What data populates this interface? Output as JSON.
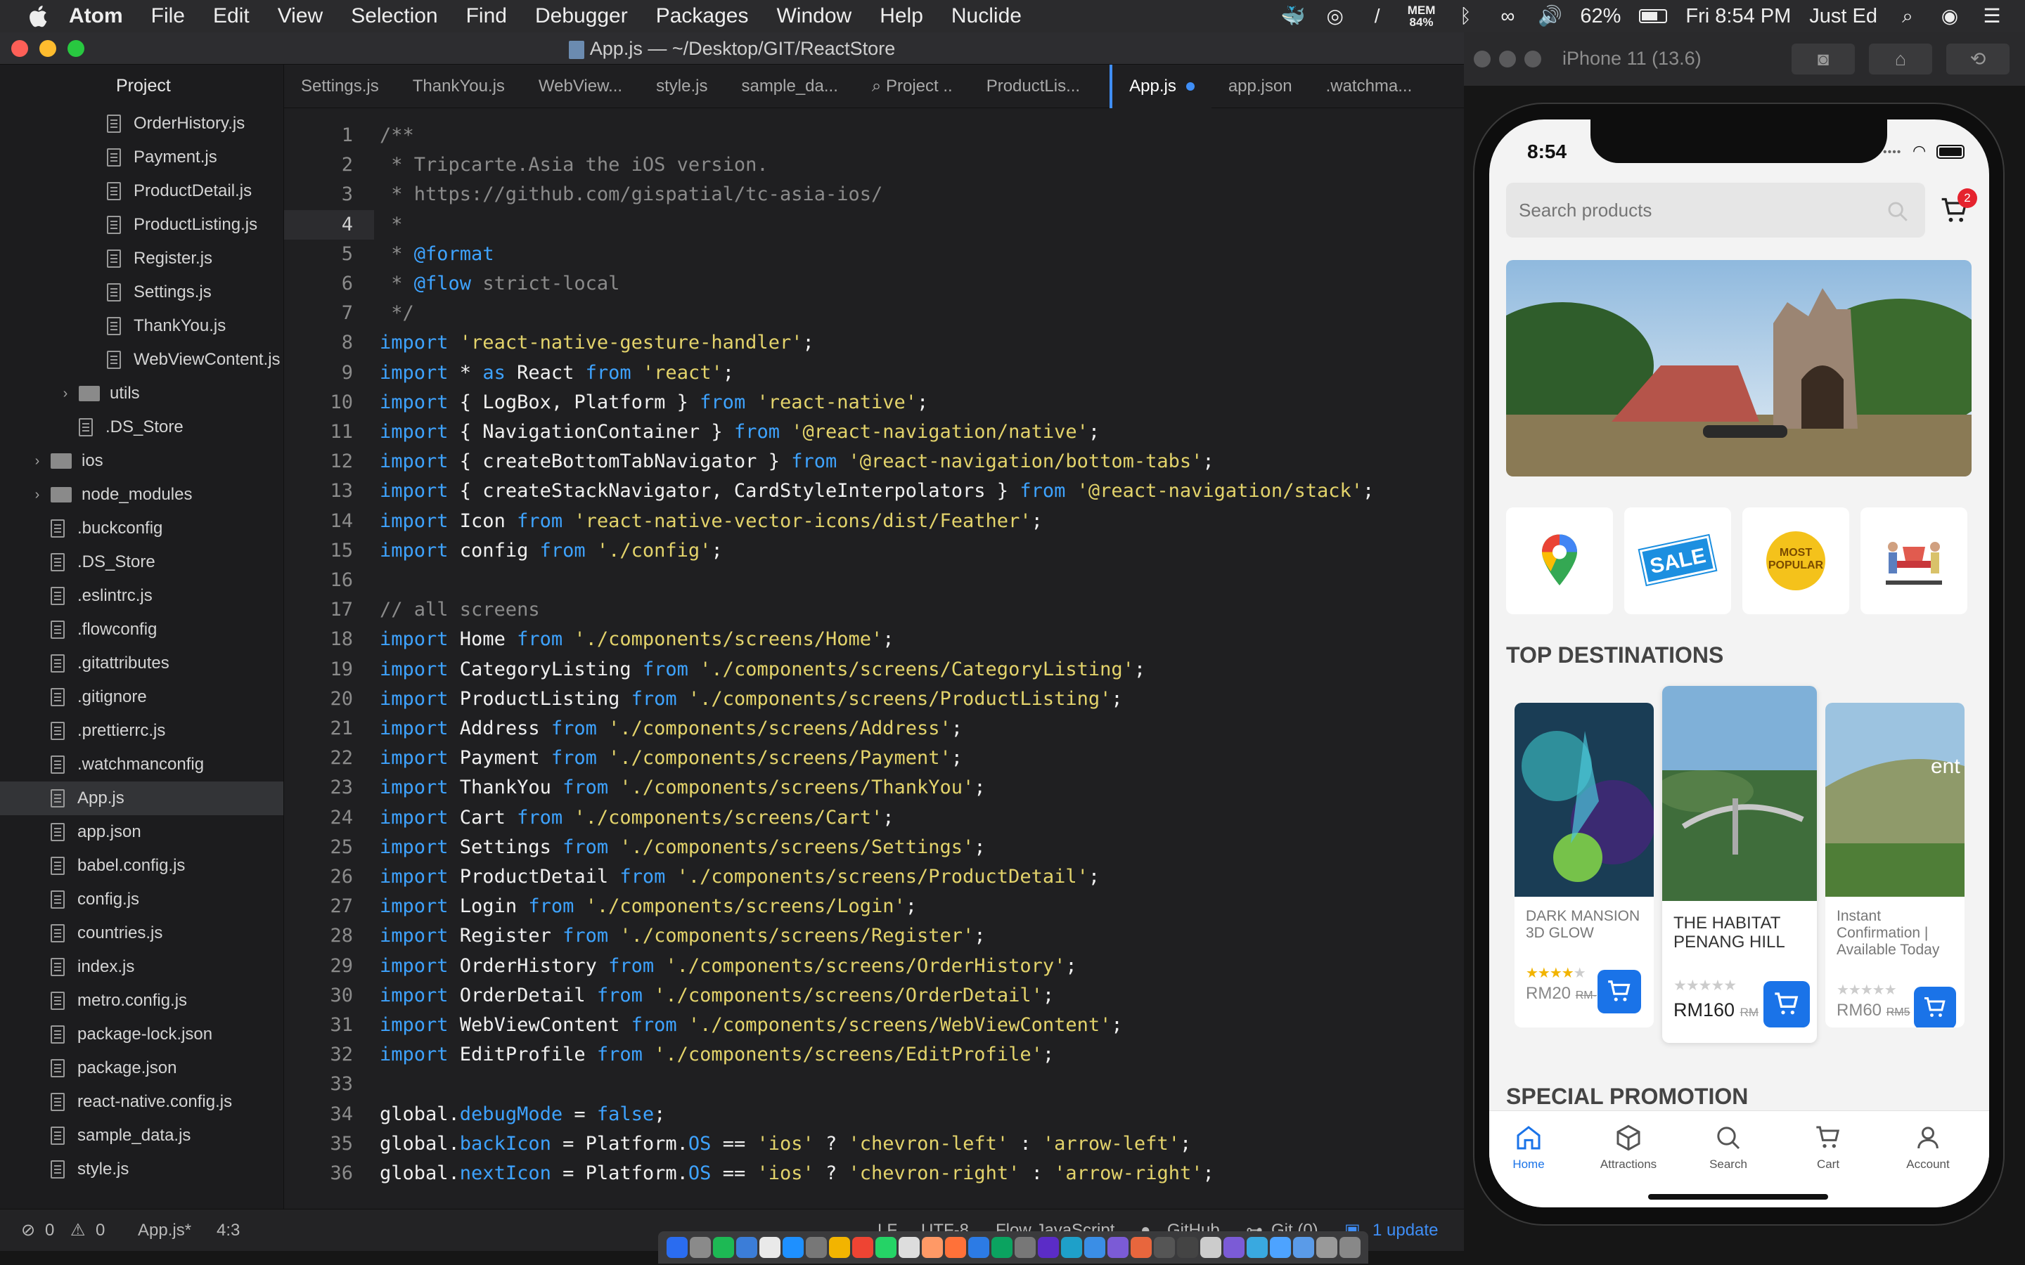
{
  "menubar": {
    "app": "Atom",
    "items": [
      "File",
      "Edit",
      "View",
      "Selection",
      "Find",
      "Debugger",
      "Packages",
      "Window",
      "Help",
      "Nuclide"
    ],
    "mem_label": "MEM",
    "mem_value": "84%",
    "battery": "62%",
    "clock": "Fri 8:54 PM",
    "user": "Just Ed"
  },
  "atom": {
    "title": "App.js — ~/Desktop/GIT/ReactStore",
    "panel_title": "Project",
    "tree": [
      {
        "label": "OrderHistory.js",
        "kind": "file",
        "indent": 2
      },
      {
        "label": "Payment.js",
        "kind": "file",
        "indent": 2
      },
      {
        "label": "ProductDetail.js",
        "kind": "file",
        "indent": 2
      },
      {
        "label": "ProductListing.js",
        "kind": "file",
        "indent": 2
      },
      {
        "label": "Register.js",
        "kind": "file",
        "indent": 2
      },
      {
        "label": "Settings.js",
        "kind": "file",
        "indent": 2
      },
      {
        "label": "ThankYou.js",
        "kind": "file",
        "indent": 2
      },
      {
        "label": "WebViewContent.js",
        "kind": "file",
        "indent": 2
      },
      {
        "label": "utils",
        "kind": "folder",
        "indent": 1
      },
      {
        "label": ".DS_Store",
        "kind": "file",
        "indent": 1
      },
      {
        "label": "ios",
        "kind": "folder",
        "indent": 0
      },
      {
        "label": "node_modules",
        "kind": "folder",
        "indent": 0
      },
      {
        "label": ".buckconfig",
        "kind": "file",
        "indent": 0
      },
      {
        "label": ".DS_Store",
        "kind": "file",
        "indent": 0
      },
      {
        "label": ".eslintrc.js",
        "kind": "file",
        "indent": 0
      },
      {
        "label": ".flowconfig",
        "kind": "file",
        "indent": 0
      },
      {
        "label": ".gitattributes",
        "kind": "file",
        "indent": 0
      },
      {
        "label": ".gitignore",
        "kind": "file",
        "indent": 0
      },
      {
        "label": ".prettierrc.js",
        "kind": "file",
        "indent": 0
      },
      {
        "label": ".watchmanconfig",
        "kind": "file",
        "indent": 0
      },
      {
        "label": "App.js",
        "kind": "file",
        "indent": 0,
        "selected": true
      },
      {
        "label": "app.json",
        "kind": "file",
        "indent": 0
      },
      {
        "label": "babel.config.js",
        "kind": "file",
        "indent": 0
      },
      {
        "label": "config.js",
        "kind": "file",
        "indent": 0
      },
      {
        "label": "countries.js",
        "kind": "file",
        "indent": 0
      },
      {
        "label": "index.js",
        "kind": "file",
        "indent": 0
      },
      {
        "label": "metro.config.js",
        "kind": "file",
        "indent": 0
      },
      {
        "label": "package-lock.json",
        "kind": "file",
        "indent": 0
      },
      {
        "label": "package.json",
        "kind": "file",
        "indent": 0
      },
      {
        "label": "react-native.config.js",
        "kind": "file",
        "indent": 0
      },
      {
        "label": "sample_data.js",
        "kind": "file",
        "indent": 0
      },
      {
        "label": "style.js",
        "kind": "file",
        "indent": 0
      }
    ],
    "tabs": [
      {
        "label": "Settings.js"
      },
      {
        "label": "ThankYou.js"
      },
      {
        "label": "WebView..."
      },
      {
        "label": "style.js"
      },
      {
        "label": "sample_da..."
      },
      {
        "label": "Project ..",
        "search": true
      },
      {
        "label": "ProductLis..."
      },
      {
        "label": "App.js",
        "active": true,
        "modified": true
      },
      {
        "label": "app.json"
      },
      {
        "label": ".watchma..."
      }
    ],
    "cursor_line": 4,
    "code": [
      [
        [
          "c",
          "/**"
        ]
      ],
      [
        [
          "c",
          " * Tripcarte.Asia the iOS version."
        ]
      ],
      [
        [
          "c",
          " * https://github.com/gispatial/tc-asia-ios/"
        ]
      ],
      [
        [
          "c",
          " *"
        ]
      ],
      [
        [
          "c",
          " * "
        ],
        [
          "k",
          "@format"
        ]
      ],
      [
        [
          "c",
          " * "
        ],
        [
          "k",
          "@flow"
        ],
        [
          "c",
          " strict-local"
        ]
      ],
      [
        [
          "c",
          " */"
        ]
      ],
      [
        [
          "k",
          "import "
        ],
        [
          "s",
          "'react-native-gesture-handler'"
        ],
        [
          "n",
          ";"
        ]
      ],
      [
        [
          "k",
          "import "
        ],
        [
          "n",
          "* "
        ],
        [
          "k",
          "as "
        ],
        [
          "n",
          "React "
        ],
        [
          "k",
          "from "
        ],
        [
          "s",
          "'react'"
        ],
        [
          "n",
          ";"
        ]
      ],
      [
        [
          "k",
          "import "
        ],
        [
          "n",
          "{ LogBox, Platform } "
        ],
        [
          "k",
          "from "
        ],
        [
          "s",
          "'react-native'"
        ],
        [
          "n",
          ";"
        ]
      ],
      [
        [
          "k",
          "import "
        ],
        [
          "n",
          "{ NavigationContainer } "
        ],
        [
          "k",
          "from "
        ],
        [
          "s",
          "'@react-navigation/native'"
        ],
        [
          "n",
          ";"
        ]
      ],
      [
        [
          "k",
          "import "
        ],
        [
          "n",
          "{ createBottomTabNavigator } "
        ],
        [
          "k",
          "from "
        ],
        [
          "s",
          "'@react-navigation/bottom-tabs'"
        ],
        [
          "n",
          ";"
        ]
      ],
      [
        [
          "k",
          "import "
        ],
        [
          "n",
          "{ createStackNavigator, CardStyleInterpolators } "
        ],
        [
          "k",
          "from "
        ],
        [
          "s",
          "'@react-navigation/stack'"
        ],
        [
          "n",
          ";"
        ]
      ],
      [
        [
          "k",
          "import "
        ],
        [
          "n",
          "Icon "
        ],
        [
          "k",
          "from "
        ],
        [
          "s",
          "'react-native-vector-icons/dist/Feather'"
        ],
        [
          "n",
          ";"
        ]
      ],
      [
        [
          "k",
          "import "
        ],
        [
          "n",
          "config "
        ],
        [
          "k",
          "from "
        ],
        [
          "s",
          "'./config'"
        ],
        [
          "n",
          ";"
        ]
      ],
      [],
      [
        [
          "c",
          "// all screens"
        ]
      ],
      [
        [
          "k",
          "import "
        ],
        [
          "n",
          "Home "
        ],
        [
          "k",
          "from "
        ],
        [
          "s",
          "'./components/screens/Home'"
        ],
        [
          "n",
          ";"
        ]
      ],
      [
        [
          "k",
          "import "
        ],
        [
          "n",
          "CategoryListing "
        ],
        [
          "k",
          "from "
        ],
        [
          "s",
          "'./components/screens/CategoryListing'"
        ],
        [
          "n",
          ";"
        ]
      ],
      [
        [
          "k",
          "import "
        ],
        [
          "n",
          "ProductListing "
        ],
        [
          "k",
          "from "
        ],
        [
          "s",
          "'./components/screens/ProductListing'"
        ],
        [
          "n",
          ";"
        ]
      ],
      [
        [
          "k",
          "import "
        ],
        [
          "n",
          "Address "
        ],
        [
          "k",
          "from "
        ],
        [
          "s",
          "'./components/screens/Address'"
        ],
        [
          "n",
          ";"
        ]
      ],
      [
        [
          "k",
          "import "
        ],
        [
          "n",
          "Payment "
        ],
        [
          "k",
          "from "
        ],
        [
          "s",
          "'./components/screens/Payment'"
        ],
        [
          "n",
          ";"
        ]
      ],
      [
        [
          "k",
          "import "
        ],
        [
          "n",
          "ThankYou "
        ],
        [
          "k",
          "from "
        ],
        [
          "s",
          "'./components/screens/ThankYou'"
        ],
        [
          "n",
          ";"
        ]
      ],
      [
        [
          "k",
          "import "
        ],
        [
          "n",
          "Cart "
        ],
        [
          "k",
          "from "
        ],
        [
          "s",
          "'./components/screens/Cart'"
        ],
        [
          "n",
          ";"
        ]
      ],
      [
        [
          "k",
          "import "
        ],
        [
          "n",
          "Settings "
        ],
        [
          "k",
          "from "
        ],
        [
          "s",
          "'./components/screens/Settings'"
        ],
        [
          "n",
          ";"
        ]
      ],
      [
        [
          "k",
          "import "
        ],
        [
          "n",
          "ProductDetail "
        ],
        [
          "k",
          "from "
        ],
        [
          "s",
          "'./components/screens/ProductDetail'"
        ],
        [
          "n",
          ";"
        ]
      ],
      [
        [
          "k",
          "import "
        ],
        [
          "n",
          "Login "
        ],
        [
          "k",
          "from "
        ],
        [
          "s",
          "'./components/screens/Login'"
        ],
        [
          "n",
          ";"
        ]
      ],
      [
        [
          "k",
          "import "
        ],
        [
          "n",
          "Register "
        ],
        [
          "k",
          "from "
        ],
        [
          "s",
          "'./components/screens/Register'"
        ],
        [
          "n",
          ";"
        ]
      ],
      [
        [
          "k",
          "import "
        ],
        [
          "n",
          "OrderHistory "
        ],
        [
          "k",
          "from "
        ],
        [
          "s",
          "'./components/screens/OrderHistory'"
        ],
        [
          "n",
          ";"
        ]
      ],
      [
        [
          "k",
          "import "
        ],
        [
          "n",
          "OrderDetail "
        ],
        [
          "k",
          "from "
        ],
        [
          "s",
          "'./components/screens/OrderDetail'"
        ],
        [
          "n",
          ";"
        ]
      ],
      [
        [
          "k",
          "import "
        ],
        [
          "n",
          "WebViewContent "
        ],
        [
          "k",
          "from "
        ],
        [
          "s",
          "'./components/screens/WebViewContent'"
        ],
        [
          "n",
          ";"
        ]
      ],
      [
        [
          "k",
          "import "
        ],
        [
          "n",
          "EditProfile "
        ],
        [
          "k",
          "from "
        ],
        [
          "s",
          "'./components/screens/EditProfile'"
        ],
        [
          "n",
          ";"
        ]
      ],
      [],
      [
        [
          "n",
          "global."
        ],
        [
          "k",
          "debugMode"
        ],
        [
          "n",
          " = "
        ],
        [
          "k",
          "false"
        ],
        [
          "n",
          ";"
        ]
      ],
      [
        [
          "n",
          "global."
        ],
        [
          "k",
          "backIcon"
        ],
        [
          "n",
          " = Platform."
        ],
        [
          "k",
          "OS"
        ],
        [
          "n",
          " == "
        ],
        [
          "s",
          "'ios'"
        ],
        [
          "n",
          " ? "
        ],
        [
          "s",
          "'chevron-left'"
        ],
        [
          "n",
          " : "
        ],
        [
          "s",
          "'arrow-left'"
        ],
        [
          "n",
          ";"
        ]
      ],
      [
        [
          "n",
          "global."
        ],
        [
          "k",
          "nextIcon"
        ],
        [
          "n",
          " = Platform."
        ],
        [
          "k",
          "OS"
        ],
        [
          "n",
          " == "
        ],
        [
          "s",
          "'ios'"
        ],
        [
          "n",
          " ? "
        ],
        [
          "s",
          "'chevron-right'"
        ],
        [
          "n",
          " : "
        ],
        [
          "s",
          "'arrow-right'"
        ],
        [
          "n",
          ";"
        ]
      ]
    ],
    "status": {
      "errors": "0",
      "warnings": "0",
      "file": "App.js*",
      "cursor": "4:3",
      "eol": "LF",
      "encoding": "UTF-8",
      "grammar": "Flow JavaScript",
      "github": "GitHub",
      "git": "Git (0)",
      "update": "1 update"
    }
  },
  "simulator": {
    "title": "iPhone 11 (13.6)",
    "time": "8:54",
    "search_placeholder": "Search products",
    "cart_badge": "2",
    "categories": [
      {
        "icon": "map-pin-icon"
      },
      {
        "icon": "sale-icon",
        "label": "SALE"
      },
      {
        "icon": "most-popular-icon",
        "label": "MOST POPULAR"
      },
      {
        "icon": "travel-icon"
      }
    ],
    "section_title": "TOP DESTINATIONS",
    "destinations": [
      {
        "name": "DARK MANSION 3D GLOW",
        "price": "RM20",
        "old_price": "RM-",
        "rating": 4
      },
      {
        "name": "THE HABITAT PENANG HILL",
        "price": "RM160",
        "old_price": "RM",
        "rating": 0
      },
      {
        "name": "Instant Confirmation | Available Today",
        "price": "RM60",
        "old_price": "RM5",
        "rating": 0
      }
    ],
    "section2_title": "SPECIAL PROMOTION",
    "tabs": [
      "Home",
      "Attractions",
      "Search",
      "Cart",
      "Account"
    ],
    "accent": "#1a73e8"
  }
}
